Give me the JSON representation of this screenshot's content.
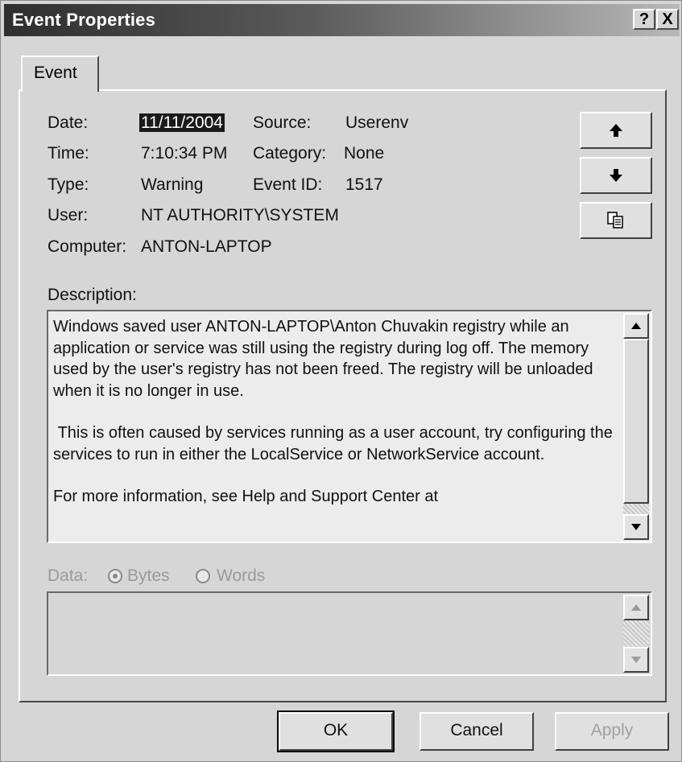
{
  "window": {
    "title": "Event Properties",
    "help_label": "?",
    "close_label": "X"
  },
  "tabs": [
    {
      "label": "Event",
      "active": true
    }
  ],
  "event": {
    "date_label": "Date:",
    "date_value": "11/11/2004",
    "time_label": "Time:",
    "time_value": "7:10:34 PM",
    "type_label": "Type:",
    "type_value": "Warning",
    "user_label": "User:",
    "user_value": "NT AUTHORITY\\SYSTEM",
    "computer_label": "Computer:",
    "computer_value": "ANTON-LAPTOP",
    "source_label": "Source:",
    "source_value": "Userenv",
    "category_label": "Category:",
    "category_value": "None",
    "event_id_label": "Event ID:",
    "event_id_value": "1517"
  },
  "side_buttons": {
    "previous_icon": "arrow-up-icon",
    "next_icon": "arrow-down-icon",
    "copy_icon": "copy-icon"
  },
  "description": {
    "label": "Description:",
    "paragraphs": [
      "Windows saved user ANTON-LAPTOP\\Anton Chuvakin registry while an application or service was still using the registry during log off. The memory used by the user's registry has not been freed. The registry will be unloaded when it is no longer in use.",
      " This is often caused by services running as a user account, try configuring the services to run in either the LocalService or NetworkService account.",
      "For more information, see Help and Support Center at"
    ]
  },
  "data_section": {
    "label": "Data:",
    "bytes_label": "Bytes",
    "words_label": "Words",
    "selected": "Bytes"
  },
  "buttons": {
    "ok": "OK",
    "cancel": "Cancel",
    "apply": "Apply"
  }
}
